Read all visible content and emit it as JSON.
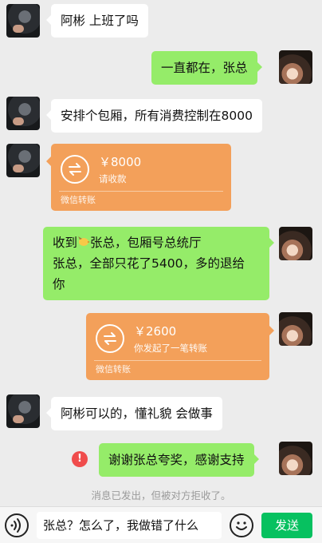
{
  "messages": [
    {
      "text": "阿彬 上班了吗"
    },
    {
      "text": "一直都在，张总"
    },
    {
      "text": "安排个包厢，所有消费控制在8000"
    },
    {
      "text_line1_prefix": "收到",
      "text_line1_suffix": "张总，包厢号总统厅",
      "text_line2": "张总，全部只花了5400，多的退给",
      "text_line3": "你"
    },
    {
      "text": "阿彬可以的，懂礼貌 会做事"
    },
    {
      "text": "谢谢张总夸奖，感谢支持"
    }
  ],
  "transfers": [
    {
      "amount": "￥8000",
      "sub": "请收款",
      "foot": "微信转账"
    },
    {
      "amount": "￥2600",
      "sub": "你发起了一笔转账",
      "foot": "微信转账"
    }
  ],
  "error_mark": "!",
  "system_note": "消息已发出，但被对方拒收了。",
  "input": {
    "value": "张总？怎么了，我做错了什么"
  },
  "send_label": "发送",
  "colors": {
    "green_bubble": "#95ec69",
    "transfer": "#f3a05a",
    "send": "#07c160",
    "error": "#f04c4c"
  }
}
